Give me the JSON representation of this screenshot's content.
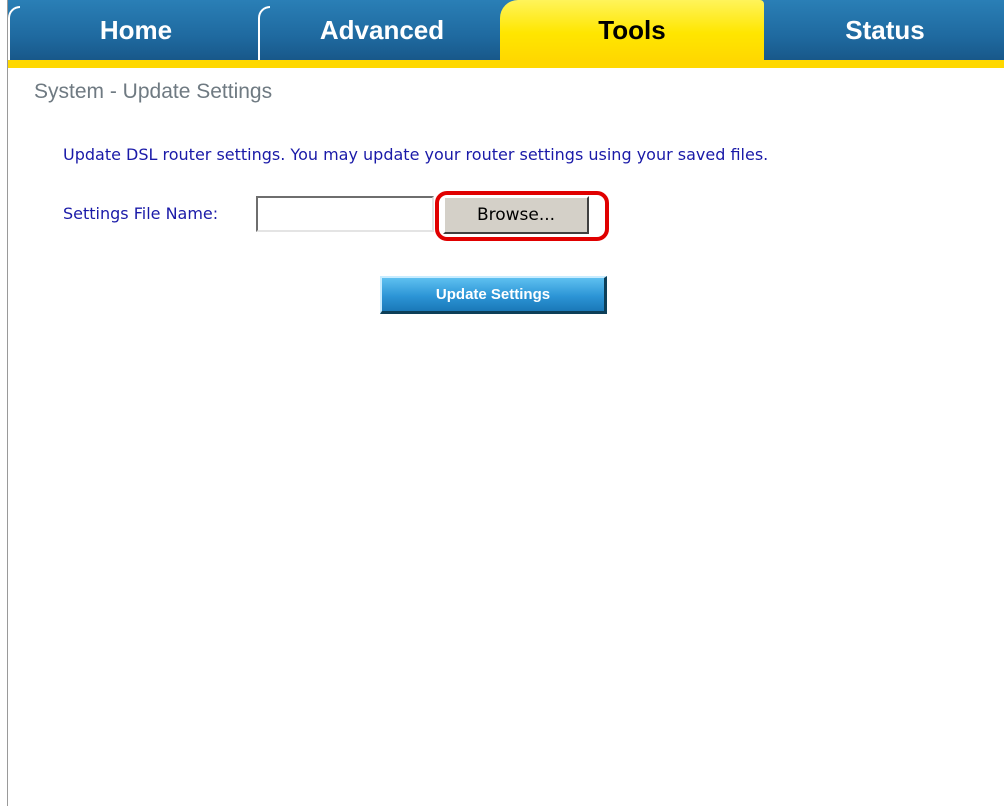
{
  "nav": {
    "tabs": [
      {
        "label": "Home"
      },
      {
        "label": "Advanced"
      },
      {
        "label": "Tools"
      },
      {
        "label": "Status"
      }
    ],
    "active_tab": "Tools"
  },
  "page": {
    "title": "System - Update Settings",
    "description": "Update DSL router settings. You may update your router settings using your saved files."
  },
  "form": {
    "file_label": "Settings File Name:",
    "file_value": "",
    "browse_label": "Browse...",
    "update_label": "Update Settings"
  },
  "colors": {
    "tab_blue": "#1f6aa0",
    "tab_active_yellow": "#ffe600",
    "label_text": "#1a1aa8",
    "title_text": "#6f7a82",
    "highlight": "#e00000",
    "button_blue": "#2c95d6"
  }
}
